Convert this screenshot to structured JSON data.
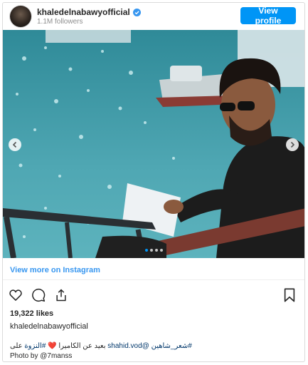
{
  "header": {
    "username": "khaledelnabawyofficial",
    "followers": "1.1M followers",
    "view_profile_label": "View profile"
  },
  "carousel": {
    "slide_count": 4,
    "active_slide": 1
  },
  "footer": {
    "view_more_label": "View more on Instagram",
    "likes": "19,322 likes",
    "caption_username": "khaledelnabawyofficial",
    "caption_hashtag1": "#شعر_شاهين",
    "caption_mention": "@shahid.vod",
    "caption_middle": "بعيد عن الكاميرا ❤️",
    "caption_hashtag2": "#النزوة",
    "caption_end": "على",
    "photo_by": "Photo by @7manss"
  },
  "colors": {
    "accent": "#0095f6",
    "link": "#3897f0",
    "sea": "#3c9aa8"
  },
  "icons": [
    "verified-icon",
    "heart-icon",
    "comment-icon",
    "share-icon",
    "bookmark-icon",
    "chevron-left-icon",
    "chevron-right-icon"
  ]
}
